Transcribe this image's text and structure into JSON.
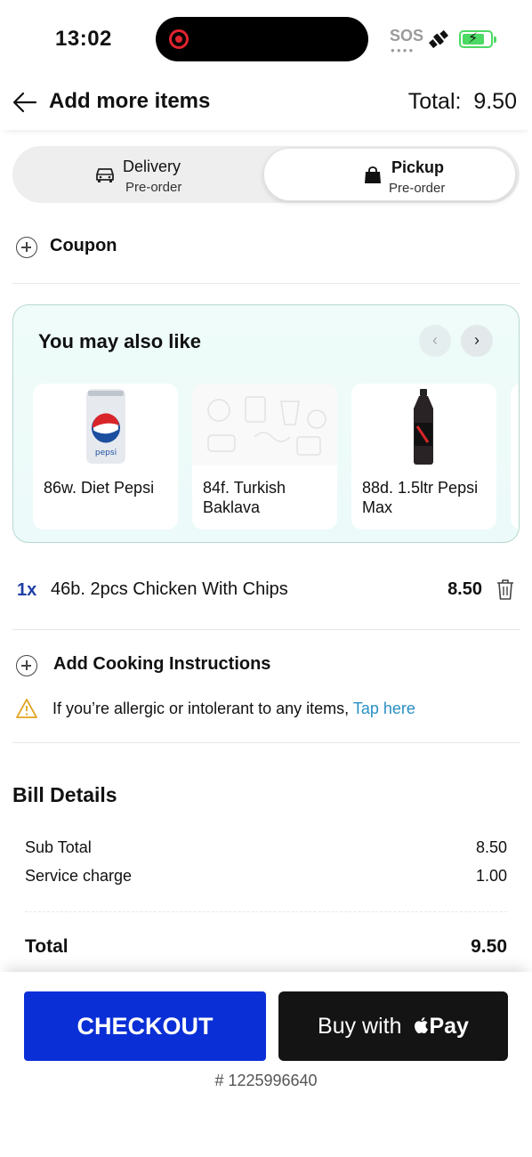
{
  "status_bar": {
    "time": "13:02",
    "sos": "SOS",
    "icons": [
      "recording-icon",
      "satellite-icon",
      "battery-charging-icon"
    ]
  },
  "header": {
    "title": "Add more items",
    "total": "Total:  9.50"
  },
  "mode_toggle": {
    "delivery": {
      "label": "Delivery",
      "sub": "Pre-order",
      "icon": "car-icon"
    },
    "pickup": {
      "label": "Pickup",
      "sub": "Pre-order",
      "icon": "bag-icon",
      "selected": true
    }
  },
  "coupon": {
    "label": "Coupon"
  },
  "suggestions": {
    "title": "You may also like",
    "items": [
      {
        "name": "86w. Diet Pepsi",
        "image": "diet-pepsi-can"
      },
      {
        "name": "84f. Turkish Baklava",
        "image": "placeholder-food-pattern"
      },
      {
        "name": "88d. 1.5ltr Pepsi Max",
        "image": "pepsi-max-bottle"
      }
    ]
  },
  "cart": {
    "items": [
      {
        "qty": "1x",
        "name": "46b. 2pcs Chicken With Chips",
        "price": "8.50"
      }
    ]
  },
  "cooking": {
    "label": "Add Cooking Instructions"
  },
  "allergy": {
    "text": "If you’re allergic or intolerant to any items, ",
    "link": "Tap here"
  },
  "bill": {
    "title": "Bill Details",
    "rows": [
      {
        "label": "Sub Total",
        "value": "8.50"
      },
      {
        "label": "Service charge",
        "value": "1.00"
      }
    ],
    "total_label": "Total",
    "total_value": "9.50"
  },
  "footer": {
    "checkout_label": "CHECKOUT",
    "applepay_prefix": "Buy with ",
    "applepay_suffix": "Pay",
    "order_id": "# 1225996640"
  },
  "colors": {
    "checkout": "#0a2fd6",
    "applepay": "#141414",
    "qty": "#1f3fa8",
    "link": "#2a8fc4",
    "suggest_bg": "#effcf9"
  }
}
